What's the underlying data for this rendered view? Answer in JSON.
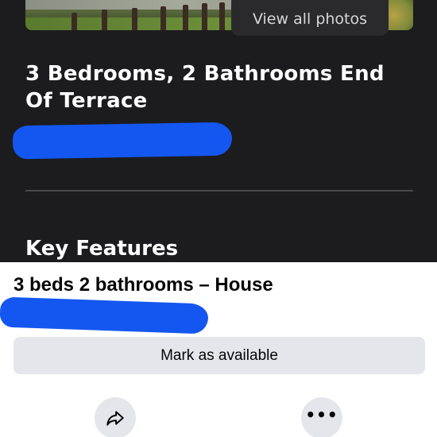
{
  "listing": {
    "view_photos_label": "View all photos",
    "title": "3 Bedrooms, 2 Bathrooms End Of Terrace",
    "section_heading": "Key Features"
  },
  "marketplace": {
    "item_title": "3 beds 2 bathrooms – House",
    "mark_available_label": "Mark as available",
    "share_icon": "share-arrow-icon",
    "more_icon": "more-dots-icon",
    "more_glyph": "•••"
  },
  "colors": {
    "dark_background": "#1c1c1e",
    "sheet_background": "#ffffff",
    "button_grey": "#e4e6eb",
    "redaction_blue": "#1457f0"
  }
}
